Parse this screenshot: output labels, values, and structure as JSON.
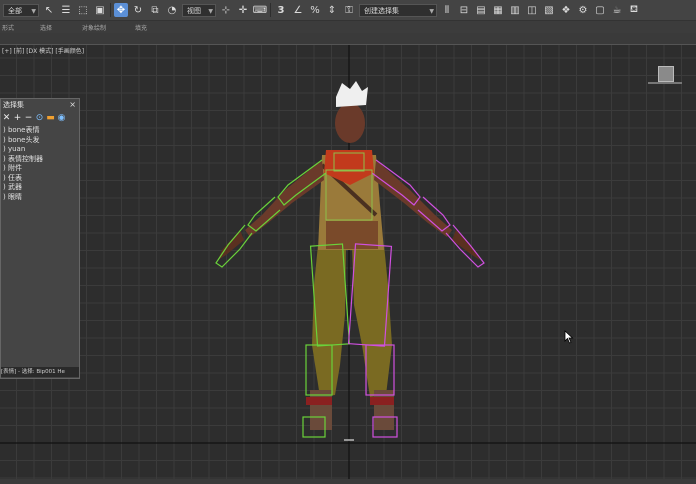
{
  "toolbar": {
    "filter_select": "全部",
    "view_select": "视图",
    "selection_set_select": "创建选择集"
  },
  "ribbon": {
    "labels": [
      "形式",
      "选择",
      "对象绘制",
      "填充"
    ]
  },
  "viewport": {
    "label": "[+] [前] [DX 模式] [手画颜色]"
  },
  "scene_panel": {
    "title": "选择集",
    "items": [
      "bone表情",
      "bone头发",
      "yuan",
      "表情控制器",
      "附件",
      "仼表",
      "武器",
      "眼睛"
    ],
    "status": "[表情] - 选择: Bip001 He"
  },
  "colors": {
    "accent_active": "#5b8fd6",
    "bone_green": "#6ad23a",
    "bone_magenta": "#d050e0",
    "scarf": "#c23a1c"
  },
  "icons": [
    "undo-icon",
    "redo-icon",
    "select-icon",
    "rect-select-icon",
    "window-crossing-icon",
    "move-icon",
    "rotate-icon",
    "scale-icon",
    "snap-icon",
    "angle-snap-icon",
    "percent-snap-icon",
    "spinner-snap-icon",
    "mirror-icon",
    "align-icon",
    "layer-icon",
    "curve-editor-icon",
    "schematic-icon",
    "material-editor-icon",
    "render-setup-icon",
    "render-frame-icon",
    "render-icon",
    "teapot-icon"
  ]
}
